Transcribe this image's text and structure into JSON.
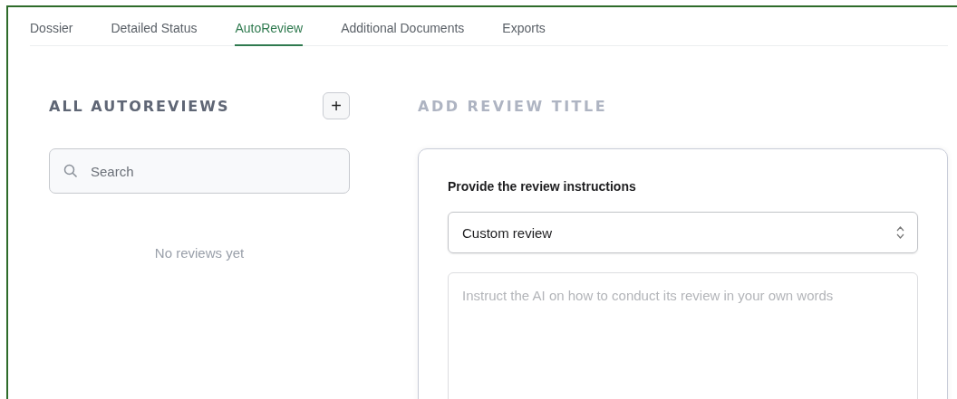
{
  "tabs": [
    {
      "label": "Dossier",
      "selected": false
    },
    {
      "label": "Detailed Status",
      "selected": false
    },
    {
      "label": "AutoReview",
      "selected": true
    },
    {
      "label": "Additional Documents",
      "selected": false
    },
    {
      "label": "Exports",
      "selected": false
    }
  ],
  "sidebar": {
    "title": "ALL AUTOREVIEWS",
    "add_button": "+",
    "search": {
      "placeholder": "Search"
    },
    "empty_message": "No reviews yet"
  },
  "review": {
    "title": {
      "placeholder": "ADD REVIEW TITLE"
    },
    "instructions_label": "Provide the review instructions",
    "review_type": {
      "value": "Custom review"
    },
    "instructions": {
      "placeholder": "Instruct the AI on how to conduct its review in your own words"
    }
  }
}
